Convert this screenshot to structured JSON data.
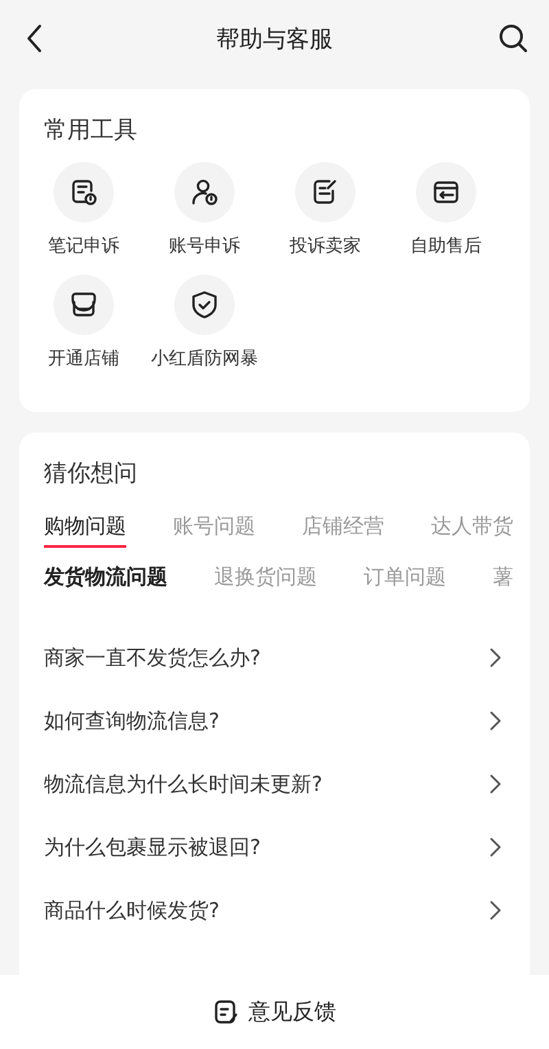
{
  "header": {
    "title": "帮助与客服"
  },
  "tools": {
    "title": "常用工具",
    "items": [
      {
        "kind": "note",
        "label": "笔记申诉"
      },
      {
        "kind": "account",
        "label": "账号申诉"
      },
      {
        "kind": "edit",
        "label": "投诉卖家"
      },
      {
        "kind": "return",
        "label": "自助售后"
      },
      {
        "kind": "shop",
        "label": "开通店铺"
      },
      {
        "kind": "shield",
        "label": "小红盾防网暴"
      }
    ]
  },
  "guess": {
    "title": "猜你想问",
    "tabs": [
      {
        "label": "购物问题",
        "selected": true
      },
      {
        "label": "账号问题",
        "selected": false
      },
      {
        "label": "店铺经营",
        "selected": false
      },
      {
        "label": "达人带货",
        "selected": false
      }
    ],
    "subtabs": [
      {
        "label": "发货物流问题",
        "selected": true
      },
      {
        "label": "退换货问题",
        "selected": false
      },
      {
        "label": "订单问题",
        "selected": false
      },
      {
        "label": "薯",
        "selected": false
      }
    ],
    "questions": [
      "商家一直不发货怎么办?",
      "如何查询物流信息?",
      "物流信息为什么长时间未更新?",
      "为什么包裹显示被退回?",
      "商品什么时候发货?"
    ]
  },
  "footer": {
    "label": "意见反馈"
  }
}
